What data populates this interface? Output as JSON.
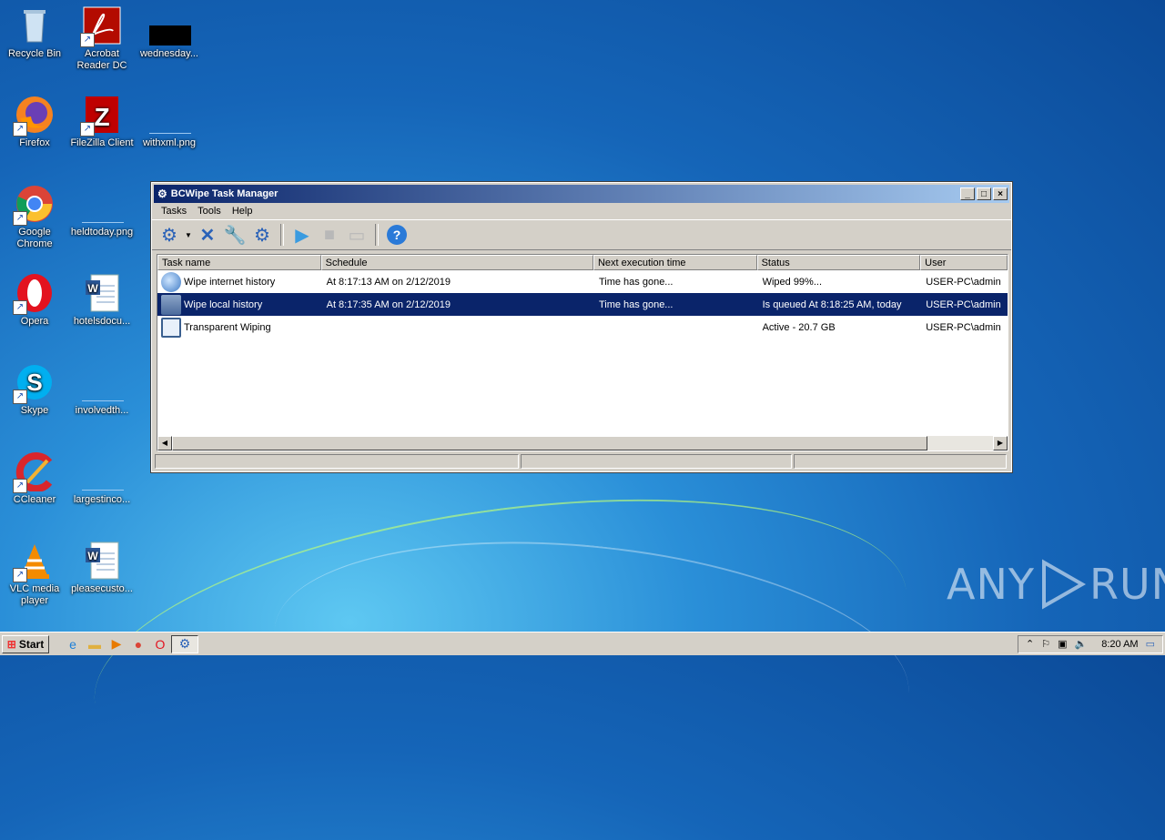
{
  "desktop": {
    "icons": [
      {
        "label": "Recycle Bin"
      },
      {
        "label": "Acrobat Reader DC"
      },
      {
        "label": "wednesday..."
      },
      {
        "label": "Firefox"
      },
      {
        "label": "FileZilla Client"
      },
      {
        "label": "withxml.png"
      },
      {
        "label": "Google Chrome"
      },
      {
        "label": "heldtoday.png"
      },
      {
        "label": "Opera"
      },
      {
        "label": "hotelsdocu..."
      },
      {
        "label": "Skype"
      },
      {
        "label": "involvedth..."
      },
      {
        "label": "CCleaner"
      },
      {
        "label": "largestinco..."
      },
      {
        "label": "VLC media player"
      },
      {
        "label": "pleasecusto..."
      }
    ]
  },
  "window": {
    "title": "BCWipe Task Manager",
    "menu": [
      "Tasks",
      "Tools",
      "Help"
    ],
    "columns": [
      "Task name",
      "Schedule",
      "Next execution time",
      "Status",
      "User"
    ],
    "rows": [
      {
        "name": "Wipe internet history",
        "schedule": "At 8:17:13 AM on 2/12/2019",
        "next": "Time has gone...",
        "status": "Wiped 99%...",
        "user": "USER-PC\\admin"
      },
      {
        "name": "Wipe local history",
        "schedule": "At 8:17:35 AM on 2/12/2019",
        "next": "Time has gone...",
        "status": "Is queued At 8:18:25 AM, today",
        "user": "USER-PC\\admin"
      },
      {
        "name": "Transparent Wiping",
        "schedule": "",
        "next": "",
        "status": "Active - 20.7 GB",
        "user": "USER-PC\\admin"
      }
    ]
  },
  "taskbar": {
    "start_label": "Start",
    "clock": "8:20 AM"
  },
  "watermark": {
    "left": "ANY",
    "right": "RUN"
  }
}
